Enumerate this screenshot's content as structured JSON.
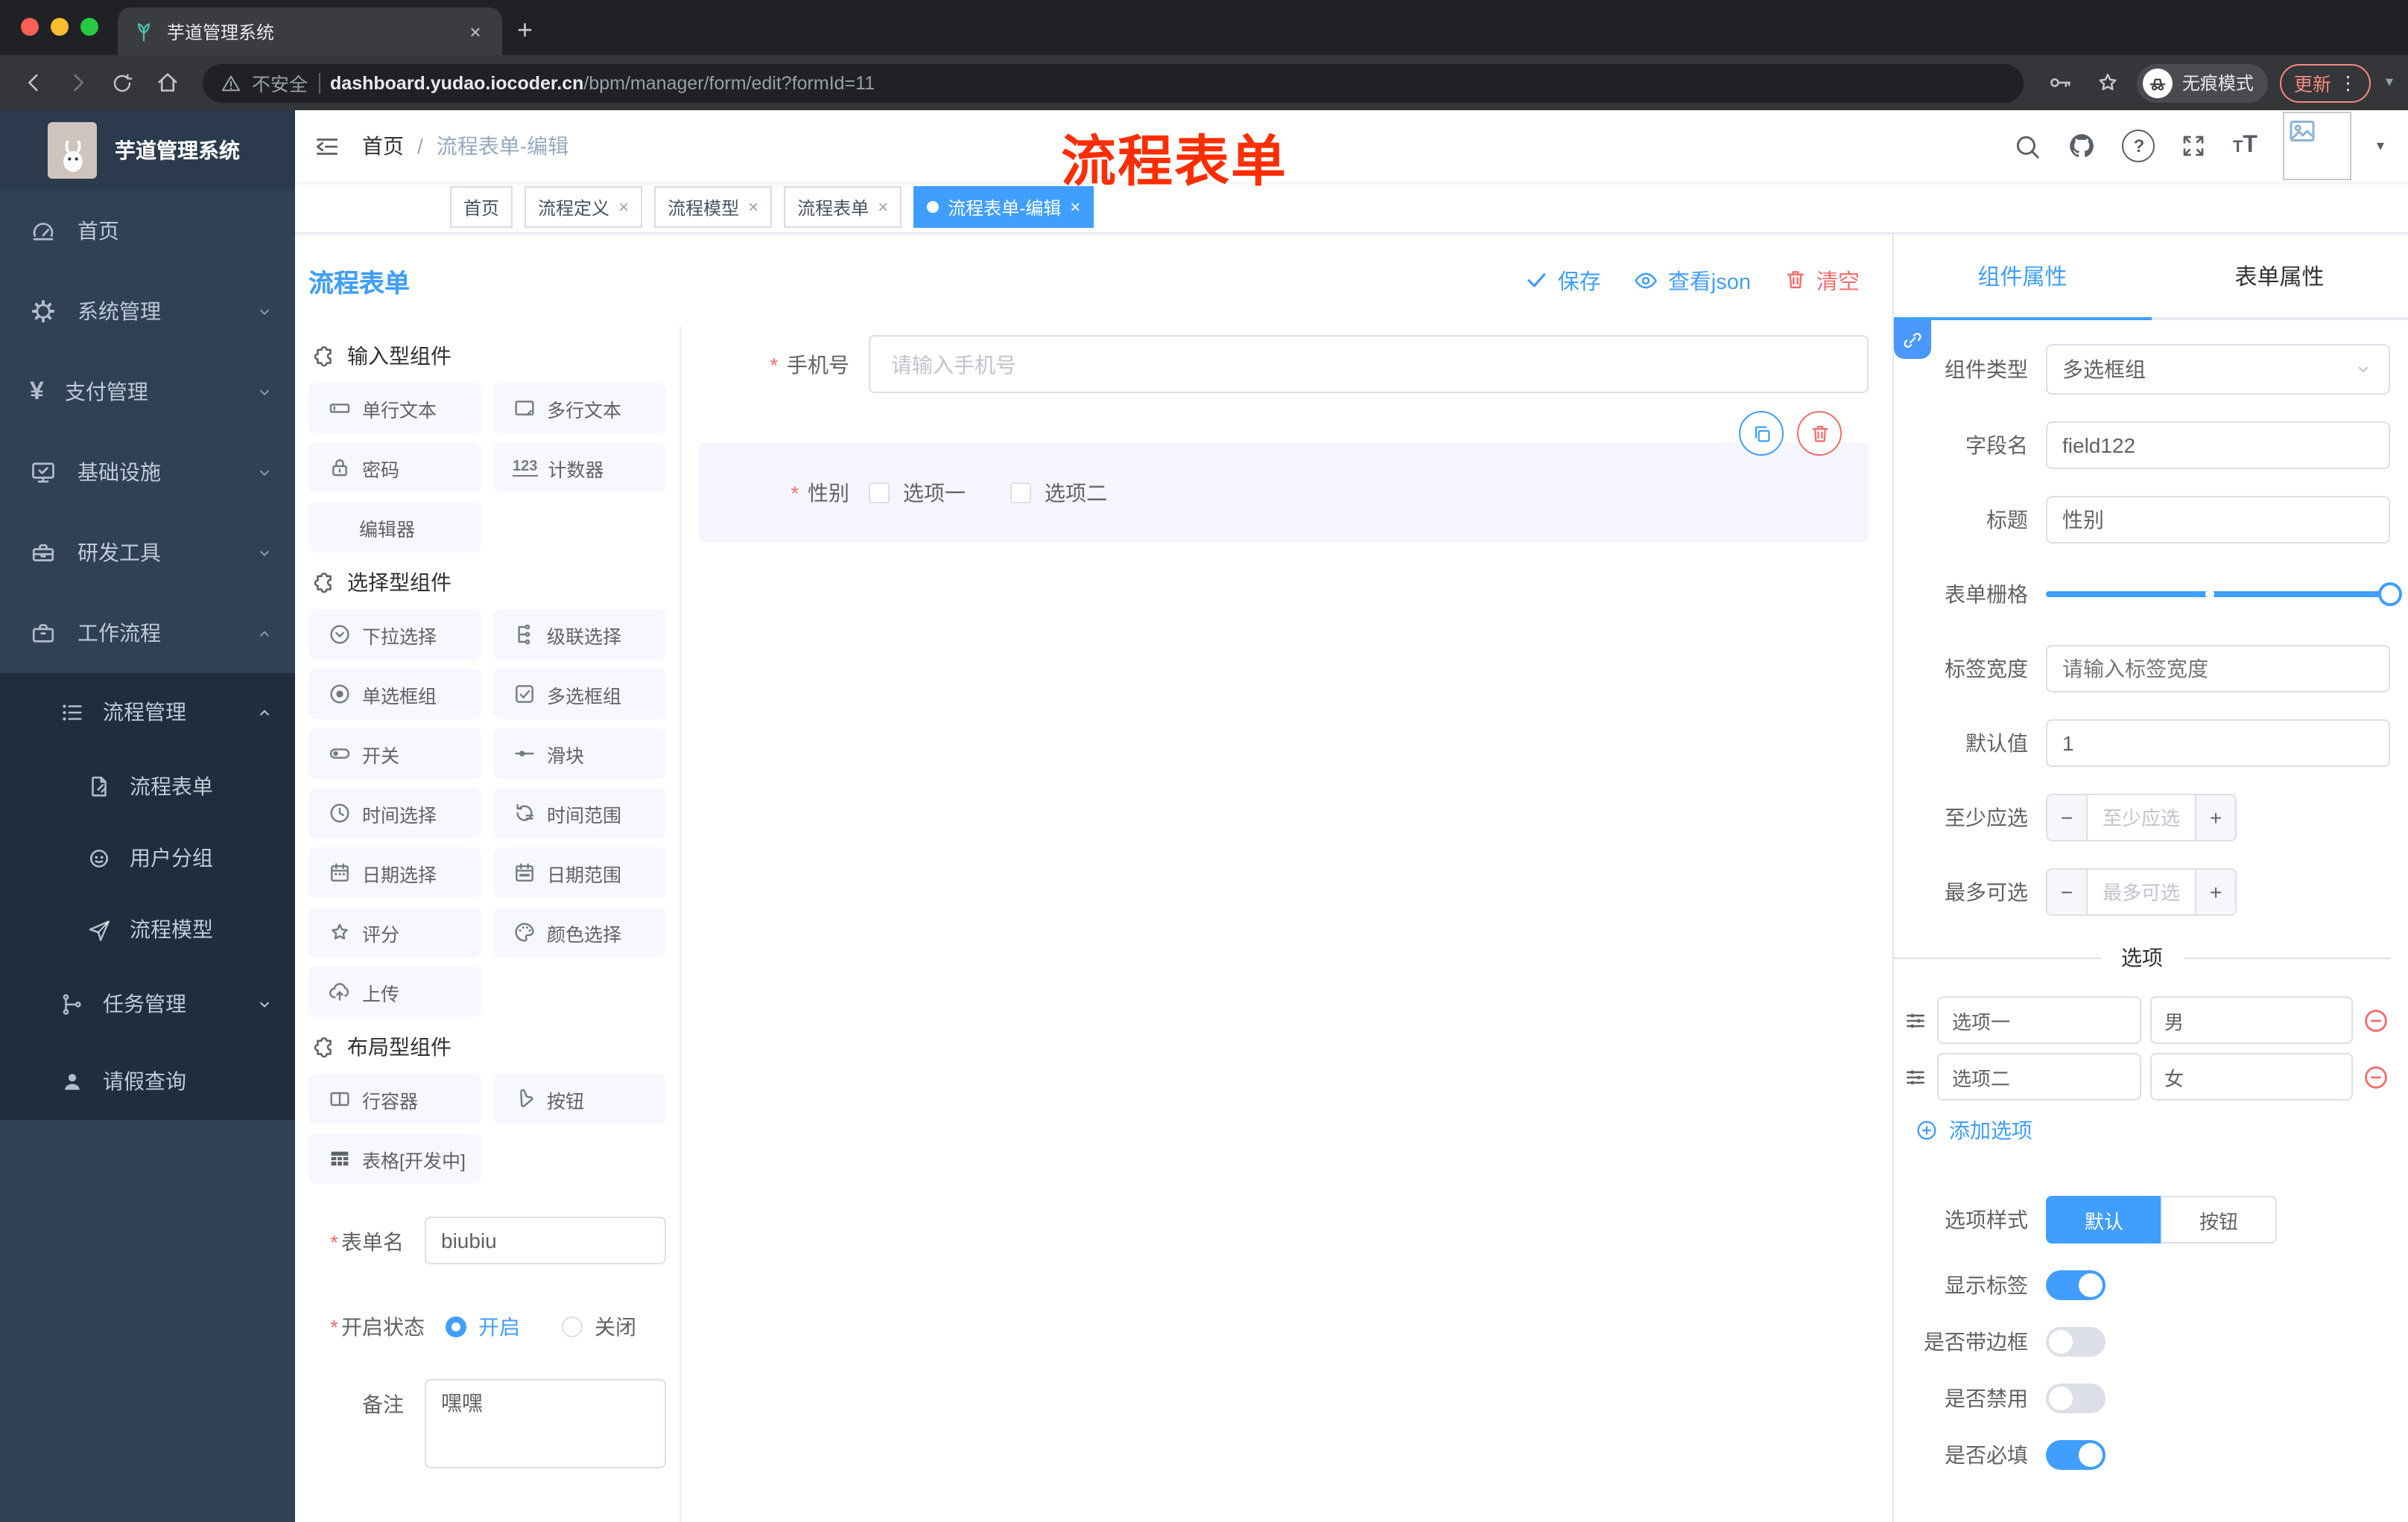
{
  "browser": {
    "tab_title": "芋道管理系统",
    "security_label": "不安全",
    "url_host": "dashboard.yudao.iocoder.cn",
    "url_path": "/bpm/manager/form/edit?formId=11",
    "incognito_label": "无痕模式",
    "update_label": "更新"
  },
  "ui": {
    "close": "×",
    "plus": "+",
    "caret": "▾",
    "dots": "⋮",
    "asterisk": "*",
    "question": "?",
    "tt_small": "T",
    "tt_big": "T",
    "counter_icon": "123",
    "yen": "¥",
    "breadcrumb_separator": "/",
    "minus": "−",
    "plus_sign": "+"
  },
  "sidebar": {
    "app_title": "芋道管理系统",
    "items": [
      {
        "label": "首页"
      },
      {
        "label": "系统管理"
      },
      {
        "label": "支付管理"
      },
      {
        "label": "基础设施"
      },
      {
        "label": "研发工具"
      },
      {
        "label": "工作流程"
      }
    ],
    "sub_items": [
      {
        "label": "流程管理"
      },
      {
        "label": "流程表单"
      },
      {
        "label": "用户分组"
      },
      {
        "label": "流程模型"
      },
      {
        "label": "任务管理"
      },
      {
        "label": "请假查询"
      }
    ]
  },
  "header": {
    "breadcrumb_home": "首页",
    "breadcrumb_current": "流程表单-编辑",
    "annotation": "流程表单"
  },
  "tags": [
    {
      "label": "首页"
    },
    {
      "label": "流程定义"
    },
    {
      "label": "流程模型"
    },
    {
      "label": "流程表单"
    },
    {
      "label": "流程表单-编辑"
    }
  ],
  "editor": {
    "title": "流程表单",
    "save_label": "保存",
    "view_json_label": "查看json",
    "clear_label": "清空"
  },
  "components": {
    "sections": [
      {
        "title": "输入型组件",
        "items": [
          {
            "label": "单行文本"
          },
          {
            "label": "多行文本"
          },
          {
            "label": "密码"
          },
          {
            "label": "计数器"
          },
          {
            "label": "编辑器"
          }
        ]
      },
      {
        "title": "选择型组件",
        "items": [
          {
            "label": "下拉选择"
          },
          {
            "label": "级联选择"
          },
          {
            "label": "单选框组"
          },
          {
            "label": "多选框组"
          },
          {
            "label": "开关"
          },
          {
            "label": "滑块"
          },
          {
            "label": "时间选择"
          },
          {
            "label": "时间范围"
          },
          {
            "label": "日期选择"
          },
          {
            "label": "日期范围"
          },
          {
            "label": "评分"
          },
          {
            "label": "颜色选择"
          },
          {
            "label": "上传"
          }
        ]
      },
      {
        "title": "布局型组件",
        "items": [
          {
            "label": "行容器"
          },
          {
            "label": "按钮"
          },
          {
            "label": "表格[开发中]"
          }
        ]
      }
    ]
  },
  "form_meta": {
    "name_label": "表单名",
    "name_value": "biubiu",
    "status_label": "开启状态",
    "status_on": "开启",
    "status_off": "关闭",
    "remark_label": "备注",
    "remark_value": "嘿嘿"
  },
  "canvas": {
    "phone_label": "手机号",
    "phone_placeholder": "请输入手机号",
    "gender_label": "性别",
    "gender_option1": "选项一",
    "gender_option2": "选项二"
  },
  "props": {
    "tab_component": "组件属性",
    "tab_form": "表单属性",
    "type_label": "组件类型",
    "type_value": "多选框组",
    "field_label": "字段名",
    "field_value": "field122",
    "title_label": "标题",
    "title_value": "性别",
    "grid_label": "表单栅格",
    "label_width_label": "标签宽度",
    "label_width_placeholder": "请输入标签宽度",
    "default_label": "默认值",
    "default_value": "1",
    "min_label": "至少应选",
    "min_placeholder": "至少应选",
    "max_label": "最多可选",
    "max_placeholder": "最多可选",
    "options_title": "选项",
    "options": [
      {
        "label": "选项一",
        "value": "男"
      },
      {
        "label": "选项二",
        "value": "女"
      }
    ],
    "add_option_label": "添加选项",
    "style_label": "选项样式",
    "style_default": "默认",
    "style_button": "按钮",
    "show_label_label": "显示标签",
    "border_label": "是否带边框",
    "disabled_label": "是否禁用",
    "required_label": "是否必填"
  },
  "colors": {
    "primary": "#409EFF",
    "danger": "#F56C6C",
    "annotation_red": "#FF2D00",
    "sidebar_bg": "#304156",
    "sidebar_submenu_bg": "#1F2D3D",
    "active_tag_bg": "#409EFF"
  }
}
